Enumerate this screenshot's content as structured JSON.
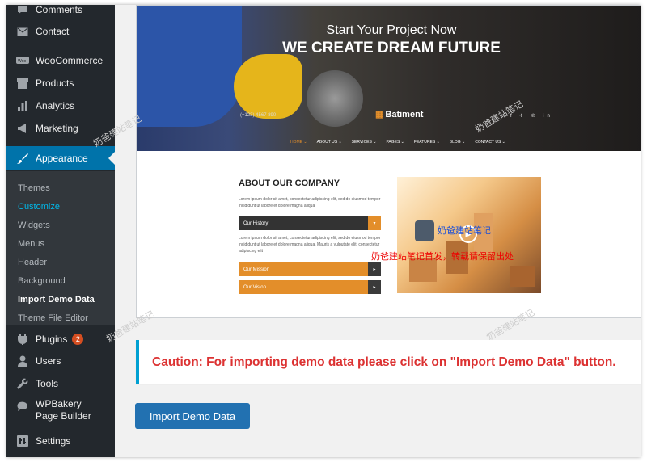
{
  "sidebar": {
    "top_items": [
      {
        "label": "Comments",
        "icon": "comments-icon"
      },
      {
        "label": "Contact",
        "icon": "mail-icon"
      },
      {
        "label": "WooCommerce",
        "icon": "woocommerce-icon"
      },
      {
        "label": "Products",
        "icon": "archive-icon"
      },
      {
        "label": "Analytics",
        "icon": "bar-chart-icon"
      },
      {
        "label": "Marketing",
        "icon": "megaphone-icon"
      }
    ],
    "active_item": {
      "label": "Appearance",
      "icon": "paintbrush-icon"
    },
    "submenu": [
      "Themes",
      "Customize",
      "Widgets",
      "Menus",
      "Header",
      "Background",
      "Import Demo Data",
      "Theme File Editor"
    ],
    "bottom_items": [
      {
        "label": "Plugins",
        "icon": "plugin-icon",
        "badge": "2"
      },
      {
        "label": "Users",
        "icon": "users-icon"
      },
      {
        "label": "Tools",
        "icon": "wrench-icon"
      },
      {
        "label": "WPBakery Page Builder",
        "icon": "wpbakery-icon"
      },
      {
        "label": "Settings",
        "icon": "settings-icon"
      }
    ],
    "colors": {
      "bg": "#23282d",
      "active": "#0073aa",
      "submenu_bg": "#32373c",
      "current": "#00b9eb"
    }
  },
  "preview": {
    "hero_subtitle": "Start Your Project Now",
    "hero_title": "WE CREATE DREAM FUTURE",
    "phone": "(+123) 4567 890",
    "logo": "Batiment",
    "social": "f ✈ ℗ in",
    "nav": [
      "HOME ⌄",
      "ABOUT US ⌄",
      "SERVICES ⌄",
      "PAGES ⌄",
      "FEATURES ⌄",
      "BLOG ⌄",
      "CONTACT US ⌄"
    ],
    "about_title": "ABOUT OUR COMPANY",
    "about_text_1": "Lorem ipsum dolor sit amet, consectetur adipiscing elit, sed do eiusmod tempor incididunt ut labore et dolore magna aliqua",
    "about_text_2": "Lorem ipsum dolor sit amet, consectetur adipiscing elit, sed do eiusmod tempor incididunt ut labore et dolore magna aliqua. Mauris a vulputate elit, consectetur adipiscing elit",
    "accordion": [
      "Our History",
      "Our Mission",
      "Our Vision"
    ],
    "accent": "#e38e2a"
  },
  "watermarks": {
    "center": "奶爸建站笔记",
    "red": "奶爸建站笔记首发，转载请保留出处"
  },
  "caution_text": "Caution: For importing demo data please click on \"Import Demo Data\" button.",
  "import_button": "Import Demo Data"
}
